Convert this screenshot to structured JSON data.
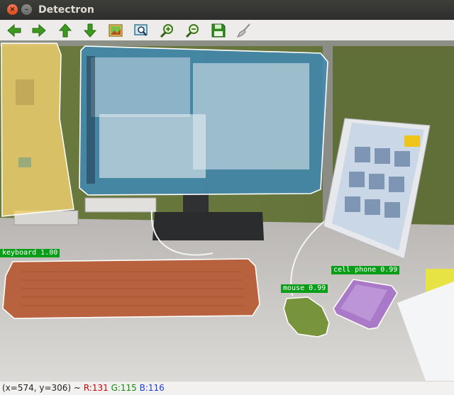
{
  "window": {
    "title": "Detectron",
    "close_glyph": "×",
    "minimize_glyph": "–"
  },
  "toolbar": {
    "items": [
      {
        "name": "back-button",
        "icon": "arrow-left-icon"
      },
      {
        "name": "forward-button",
        "icon": "arrow-right-icon"
      },
      {
        "name": "up-button",
        "icon": "arrow-up-icon"
      },
      {
        "name": "down-button",
        "icon": "arrow-down-icon"
      },
      {
        "name": "subplots-button",
        "icon": "image-icon"
      },
      {
        "name": "zoom-rect-button",
        "icon": "zoom-rect-icon"
      },
      {
        "name": "zoom-in-button",
        "icon": "zoom-in-icon"
      },
      {
        "name": "zoom-out-button",
        "icon": "zoom-out-icon"
      },
      {
        "name": "save-button",
        "icon": "floppy-disk-icon"
      },
      {
        "name": "clear-button",
        "icon": "broom-icon"
      }
    ]
  },
  "detections": [
    {
      "label": "keyboard 1.00",
      "class": "keyboard",
      "score": 1.0,
      "mask_color": "#b5532b"
    },
    {
      "label": "cell phone 0.99",
      "class": "cell phone",
      "score": 0.99,
      "mask_color": "#a36bc9"
    },
    {
      "label": "mouse 0.99",
      "class": "mouse",
      "score": 0.99,
      "mask_color": "#6e8e2c"
    }
  ],
  "masks": [
    {
      "object": "left monitor",
      "mask_color": "#efcf6e"
    },
    {
      "object": "main monitor",
      "mask_color": "#3f88b4"
    }
  ],
  "colors": {
    "label_bg": "#0a9d18",
    "outline": "#ffffff"
  },
  "status": {
    "coords": "(x=574, y=306) ~",
    "r": "R:131",
    "g": "G:115",
    "b": "B:116"
  }
}
